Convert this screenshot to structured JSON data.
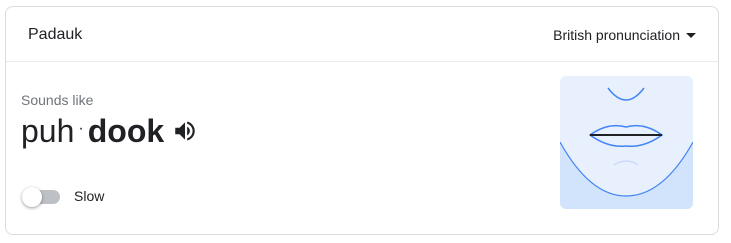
{
  "header": {
    "word": "Padauk",
    "dialect": "British pronunciation"
  },
  "pronunciation": {
    "sounds_like_label": "Sounds like",
    "syllables": [
      "puh",
      "dook"
    ],
    "separator": "·"
  },
  "controls": {
    "slow_label": "Slow",
    "slow_enabled": false
  },
  "icons": {
    "speaker": "speaker-icon",
    "dropdown": "caret-down-icon",
    "mouth": "mouth-diagram"
  },
  "colors": {
    "mouth_bg_light": "#e8f0fe",
    "mouth_bg_dark": "#d2e3fc",
    "mouth_line": "#4285f4",
    "text_primary": "#202124",
    "text_secondary": "#70757a"
  }
}
